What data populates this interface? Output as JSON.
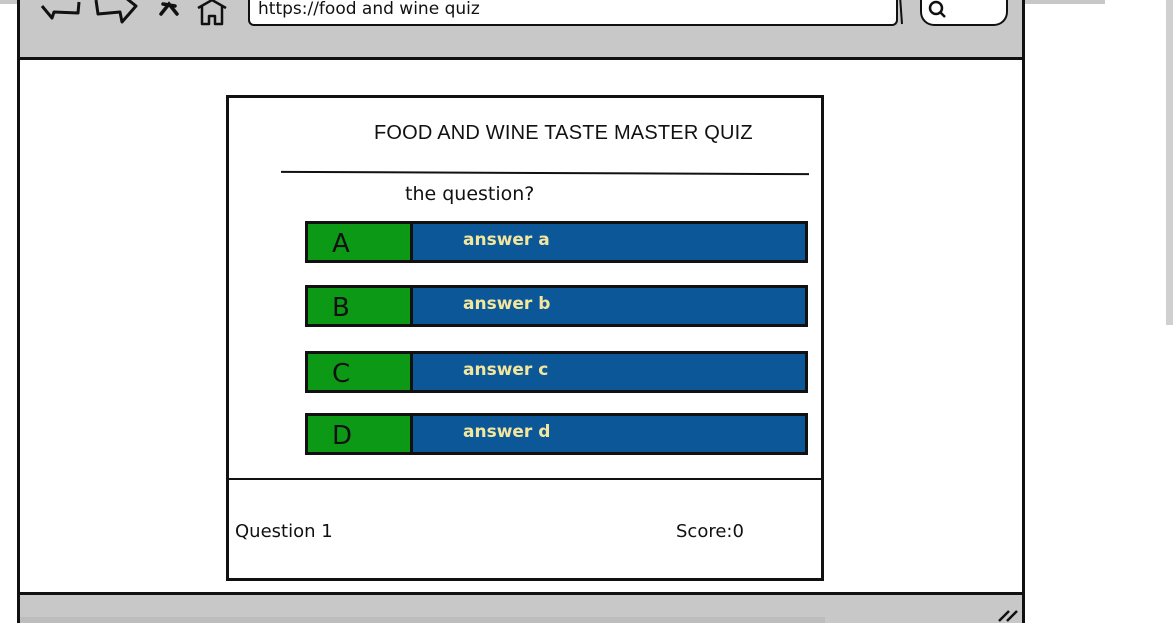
{
  "browser": {
    "url": "https://food and wine quiz",
    "icons": [
      "back-arrow-icon",
      "forward-arrow-icon",
      "close-icon",
      "home-icon",
      "search-icon",
      "resize-grip-icon"
    ]
  },
  "quiz": {
    "title": "FOOD AND WINE TASTE MASTER QUIZ",
    "question": "the question?",
    "answers": [
      {
        "letter": "A",
        "text": "answer a"
      },
      {
        "letter": "B",
        "text": "answer b"
      },
      {
        "letter": "C",
        "text": "answer c"
      },
      {
        "letter": "D",
        "text": "answer d"
      }
    ],
    "question_label": "Question 1",
    "score_label": "Score:0"
  },
  "colors": {
    "letter_bg": "#0c9a16",
    "answer_bg": "#0c5797",
    "answer_text": "#f3e79f",
    "chrome": "#c8c8c8"
  }
}
